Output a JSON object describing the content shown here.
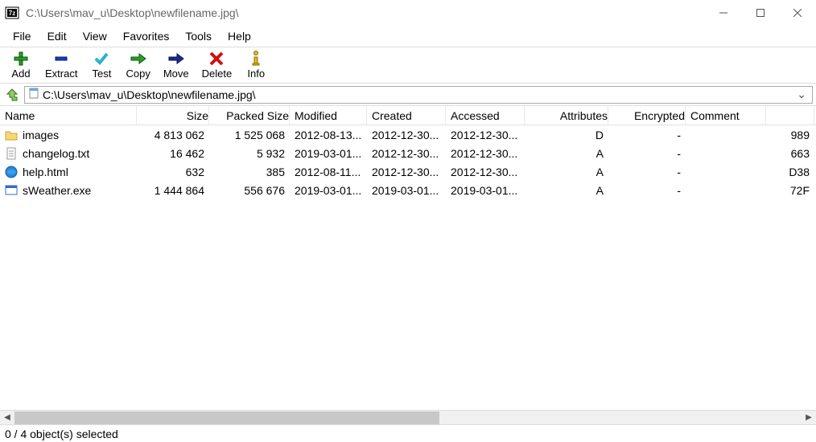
{
  "window": {
    "title": "C:\\Users\\mav_u\\Desktop\\newfilename.jpg\\"
  },
  "menus": [
    "File",
    "Edit",
    "View",
    "Favorites",
    "Tools",
    "Help"
  ],
  "toolbar": [
    {
      "id": "add",
      "label": "Add"
    },
    {
      "id": "extract",
      "label": "Extract"
    },
    {
      "id": "test",
      "label": "Test"
    },
    {
      "id": "copy",
      "label": "Copy"
    },
    {
      "id": "move",
      "label": "Move"
    },
    {
      "id": "delete",
      "label": "Delete"
    },
    {
      "id": "info",
      "label": "Info"
    }
  ],
  "address": {
    "path": "C:\\Users\\mav_u\\Desktop\\newfilename.jpg\\"
  },
  "columns": [
    "Name",
    "Size",
    "Packed Size",
    "Modified",
    "Created",
    "Accessed",
    "Attributes",
    "Encrypted",
    "Comment",
    ""
  ],
  "rows": [
    {
      "icon": "folder",
      "name": "images",
      "size": "4 813 062",
      "packed": "1 525 068",
      "mod": "2012-08-13...",
      "cre": "2012-12-30...",
      "acc": "2012-12-30...",
      "attr": "D",
      "enc": "-",
      "comm": "",
      "extra": "989"
    },
    {
      "icon": "txt",
      "name": "changelog.txt",
      "size": "16 462",
      "packed": "5 932",
      "mod": "2019-03-01...",
      "cre": "2012-12-30...",
      "acc": "2012-12-30...",
      "attr": "A",
      "enc": "-",
      "comm": "",
      "extra": "663"
    },
    {
      "icon": "html",
      "name": "help.html",
      "size": "632",
      "packed": "385",
      "mod": "2012-08-11...",
      "cre": "2012-12-30...",
      "acc": "2012-12-30...",
      "attr": "A",
      "enc": "-",
      "comm": "",
      "extra": "D38"
    },
    {
      "icon": "exe",
      "name": "sWeather.exe",
      "size": "1 444 864",
      "packed": "556 676",
      "mod": "2019-03-01...",
      "cre": "2019-03-01...",
      "acc": "2019-03-01...",
      "attr": "A",
      "enc": "-",
      "comm": "",
      "extra": "72F"
    }
  ],
  "status": "0 / 4 object(s) selected"
}
